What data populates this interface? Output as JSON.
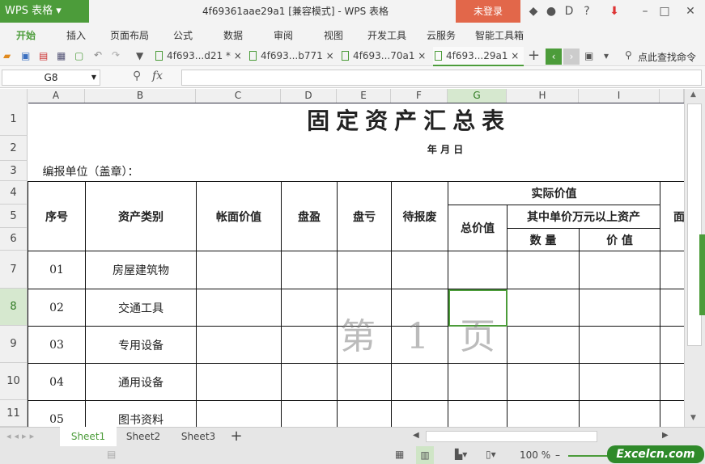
{
  "app": {
    "logo": "WPS 表格",
    "window_title": "4f69361aae29a1 [兼容模式] - WPS 表格",
    "login": "未登录",
    "help": "?"
  },
  "menu": [
    "开始",
    "插入",
    "页面布局",
    "公式",
    "数据",
    "审阅",
    "视图",
    "开发工具",
    "云服务",
    "智能工具箱"
  ],
  "tabs": [
    {
      "label": "4f693...d21 *"
    },
    {
      "label": "4f693...b771"
    },
    {
      "label": "4f693...70a1"
    },
    {
      "label": "4f693...29a1",
      "active": true
    }
  ],
  "search_placeholder": "点此查找命令",
  "formula": {
    "cell_ref": "G8",
    "fx": "fx",
    "value": ""
  },
  "columns": [
    "A",
    "B",
    "C",
    "D",
    "E",
    "F",
    "G",
    "H",
    "I",
    ""
  ],
  "rows": [
    "1",
    "2",
    "3",
    "4",
    "5",
    "6",
    "7",
    "8",
    "9",
    "10",
    "11"
  ],
  "sheet": {
    "title": "固定资产汇总表",
    "date_line": "年 月 日",
    "unit_label": "编报单位（盖章）：",
    "headers": {
      "seq": "序号",
      "category": "资产类别",
      "book_value": "帐面价值",
      "surplus": "盘盈",
      "deficit": "盘亏",
      "pending": "待报废",
      "actual": "实际价值",
      "total": "总价值",
      "over10k": "其中单价万元以上资产",
      "qty": "数 量",
      "value": "价 值",
      "cut": "面"
    },
    "data": [
      {
        "seq": "01",
        "category": "房屋建筑物"
      },
      {
        "seq": "02",
        "category": "交通工具"
      },
      {
        "seq": "03",
        "category": "专用设备"
      },
      {
        "seq": "04",
        "category": "通用设备"
      },
      {
        "seq": "05",
        "category": "图书资料"
      }
    ],
    "watermark": "第 1 页"
  },
  "sheet_tabs": [
    "Sheet1",
    "Sheet2",
    "Sheet3"
  ],
  "status": {
    "zoom": "100 %",
    "brand": "Excelcn.com"
  },
  "colors": {
    "accent": "#4c9c3a",
    "login": "#e2674a"
  }
}
